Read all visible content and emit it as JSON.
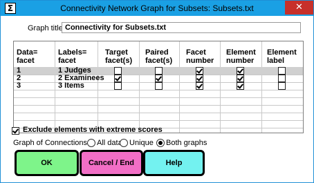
{
  "window": {
    "title": "Connectivity Network Graph for Subsets: Subsets.txt",
    "icon_glyph": "Σ",
    "close_glyph": "✕"
  },
  "graph_title": {
    "label": "Graph title:",
    "value": "Connectivity for Subsets.txt"
  },
  "table": {
    "headers": [
      [
        "Data=",
        "facet"
      ],
      [
        "Labels=",
        "facet"
      ],
      [
        "Target",
        "facet(s)"
      ],
      [
        "Paired",
        "facet(s)"
      ],
      [
        "Facet",
        "number"
      ],
      [
        "Element",
        "number"
      ],
      [
        "Element",
        "label"
      ]
    ],
    "rows": [
      {
        "data": "1",
        "label": "1 Judges",
        "target": false,
        "paired": false,
        "facet_number": true,
        "element_number": true,
        "element_label": false,
        "selected": true
      },
      {
        "data": "2",
        "label": "2 Examinees",
        "target": true,
        "paired": true,
        "facet_number": true,
        "element_number": true,
        "element_label": false,
        "selected": false
      },
      {
        "data": "3",
        "label": "3 Items",
        "target": false,
        "paired": false,
        "facet_number": true,
        "element_number": true,
        "element_label": false,
        "selected": false
      }
    ]
  },
  "exclude": {
    "label": "Exclude elements with extreme scores",
    "checked": true
  },
  "connections": {
    "label": "Graph of Connections:",
    "options": [
      "All data",
      "Unique",
      "Both graphs"
    ],
    "selected": "Both graphs"
  },
  "buttons": {
    "ok": "OK",
    "cancel": "Cancel / End",
    "help": "Help"
  },
  "colors": {
    "titlebar": "#1aa0e4",
    "close": "#c7302a",
    "ok": "#7ef48a",
    "cancel": "#f26ec6",
    "help": "#73f2f0"
  }
}
